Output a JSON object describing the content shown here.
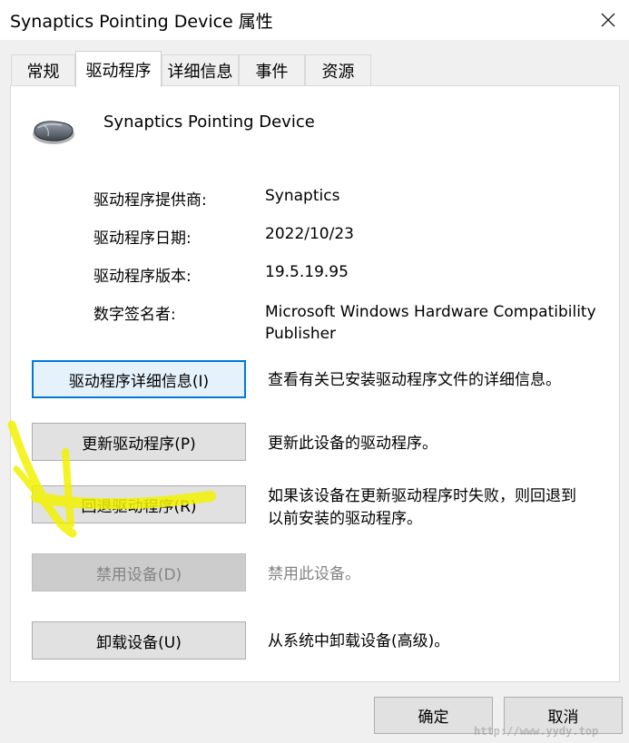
{
  "window": {
    "title": "Synaptics Pointing Device 属性",
    "close_icon": "close-icon"
  },
  "tabs": [
    {
      "label": "常规",
      "active": false
    },
    {
      "label": "驱动程序",
      "active": true
    },
    {
      "label": "详细信息",
      "active": false
    },
    {
      "label": "事件",
      "active": false
    },
    {
      "label": "资源",
      "active": false
    }
  ],
  "device": {
    "name": "Synaptics Pointing Device",
    "icon": "mouse-icon"
  },
  "driver_info": [
    {
      "label": "驱动程序提供商:",
      "value": "Synaptics"
    },
    {
      "label": "驱动程序日期:",
      "value": "2022/10/23"
    },
    {
      "label": "驱动程序版本:",
      "value": "19.5.19.95"
    },
    {
      "label": "数字签名者:",
      "value": "Microsoft Windows Hardware Compatibility\nPublisher"
    }
  ],
  "actions": [
    {
      "label": "驱动程序详细信息(I)",
      "description": "查看有关已安装驱动程序文件的详细信息。",
      "enabled": true,
      "focused": true
    },
    {
      "label": "更新驱动程序(P)",
      "description": "更新此设备的驱动程序。",
      "enabled": true,
      "focused": false
    },
    {
      "label": "回退驱动程序(R)",
      "description": "如果该设备在更新驱动程序时失败，则回退到\n以前安装的驱动程序。",
      "enabled": true,
      "focused": false
    },
    {
      "label": "禁用设备(D)",
      "description": "禁用此设备。",
      "enabled": false,
      "focused": false
    },
    {
      "label": "卸载设备(U)",
      "description": "从系统中卸载设备(高级)。",
      "enabled": true,
      "focused": false
    }
  ],
  "footer": {
    "ok_label": "确定",
    "cancel_label": "取消"
  },
  "watermark": "http://www.yydy.top",
  "colors": {
    "highlighter": "#f5f500",
    "focus_border": "#0078d7"
  }
}
